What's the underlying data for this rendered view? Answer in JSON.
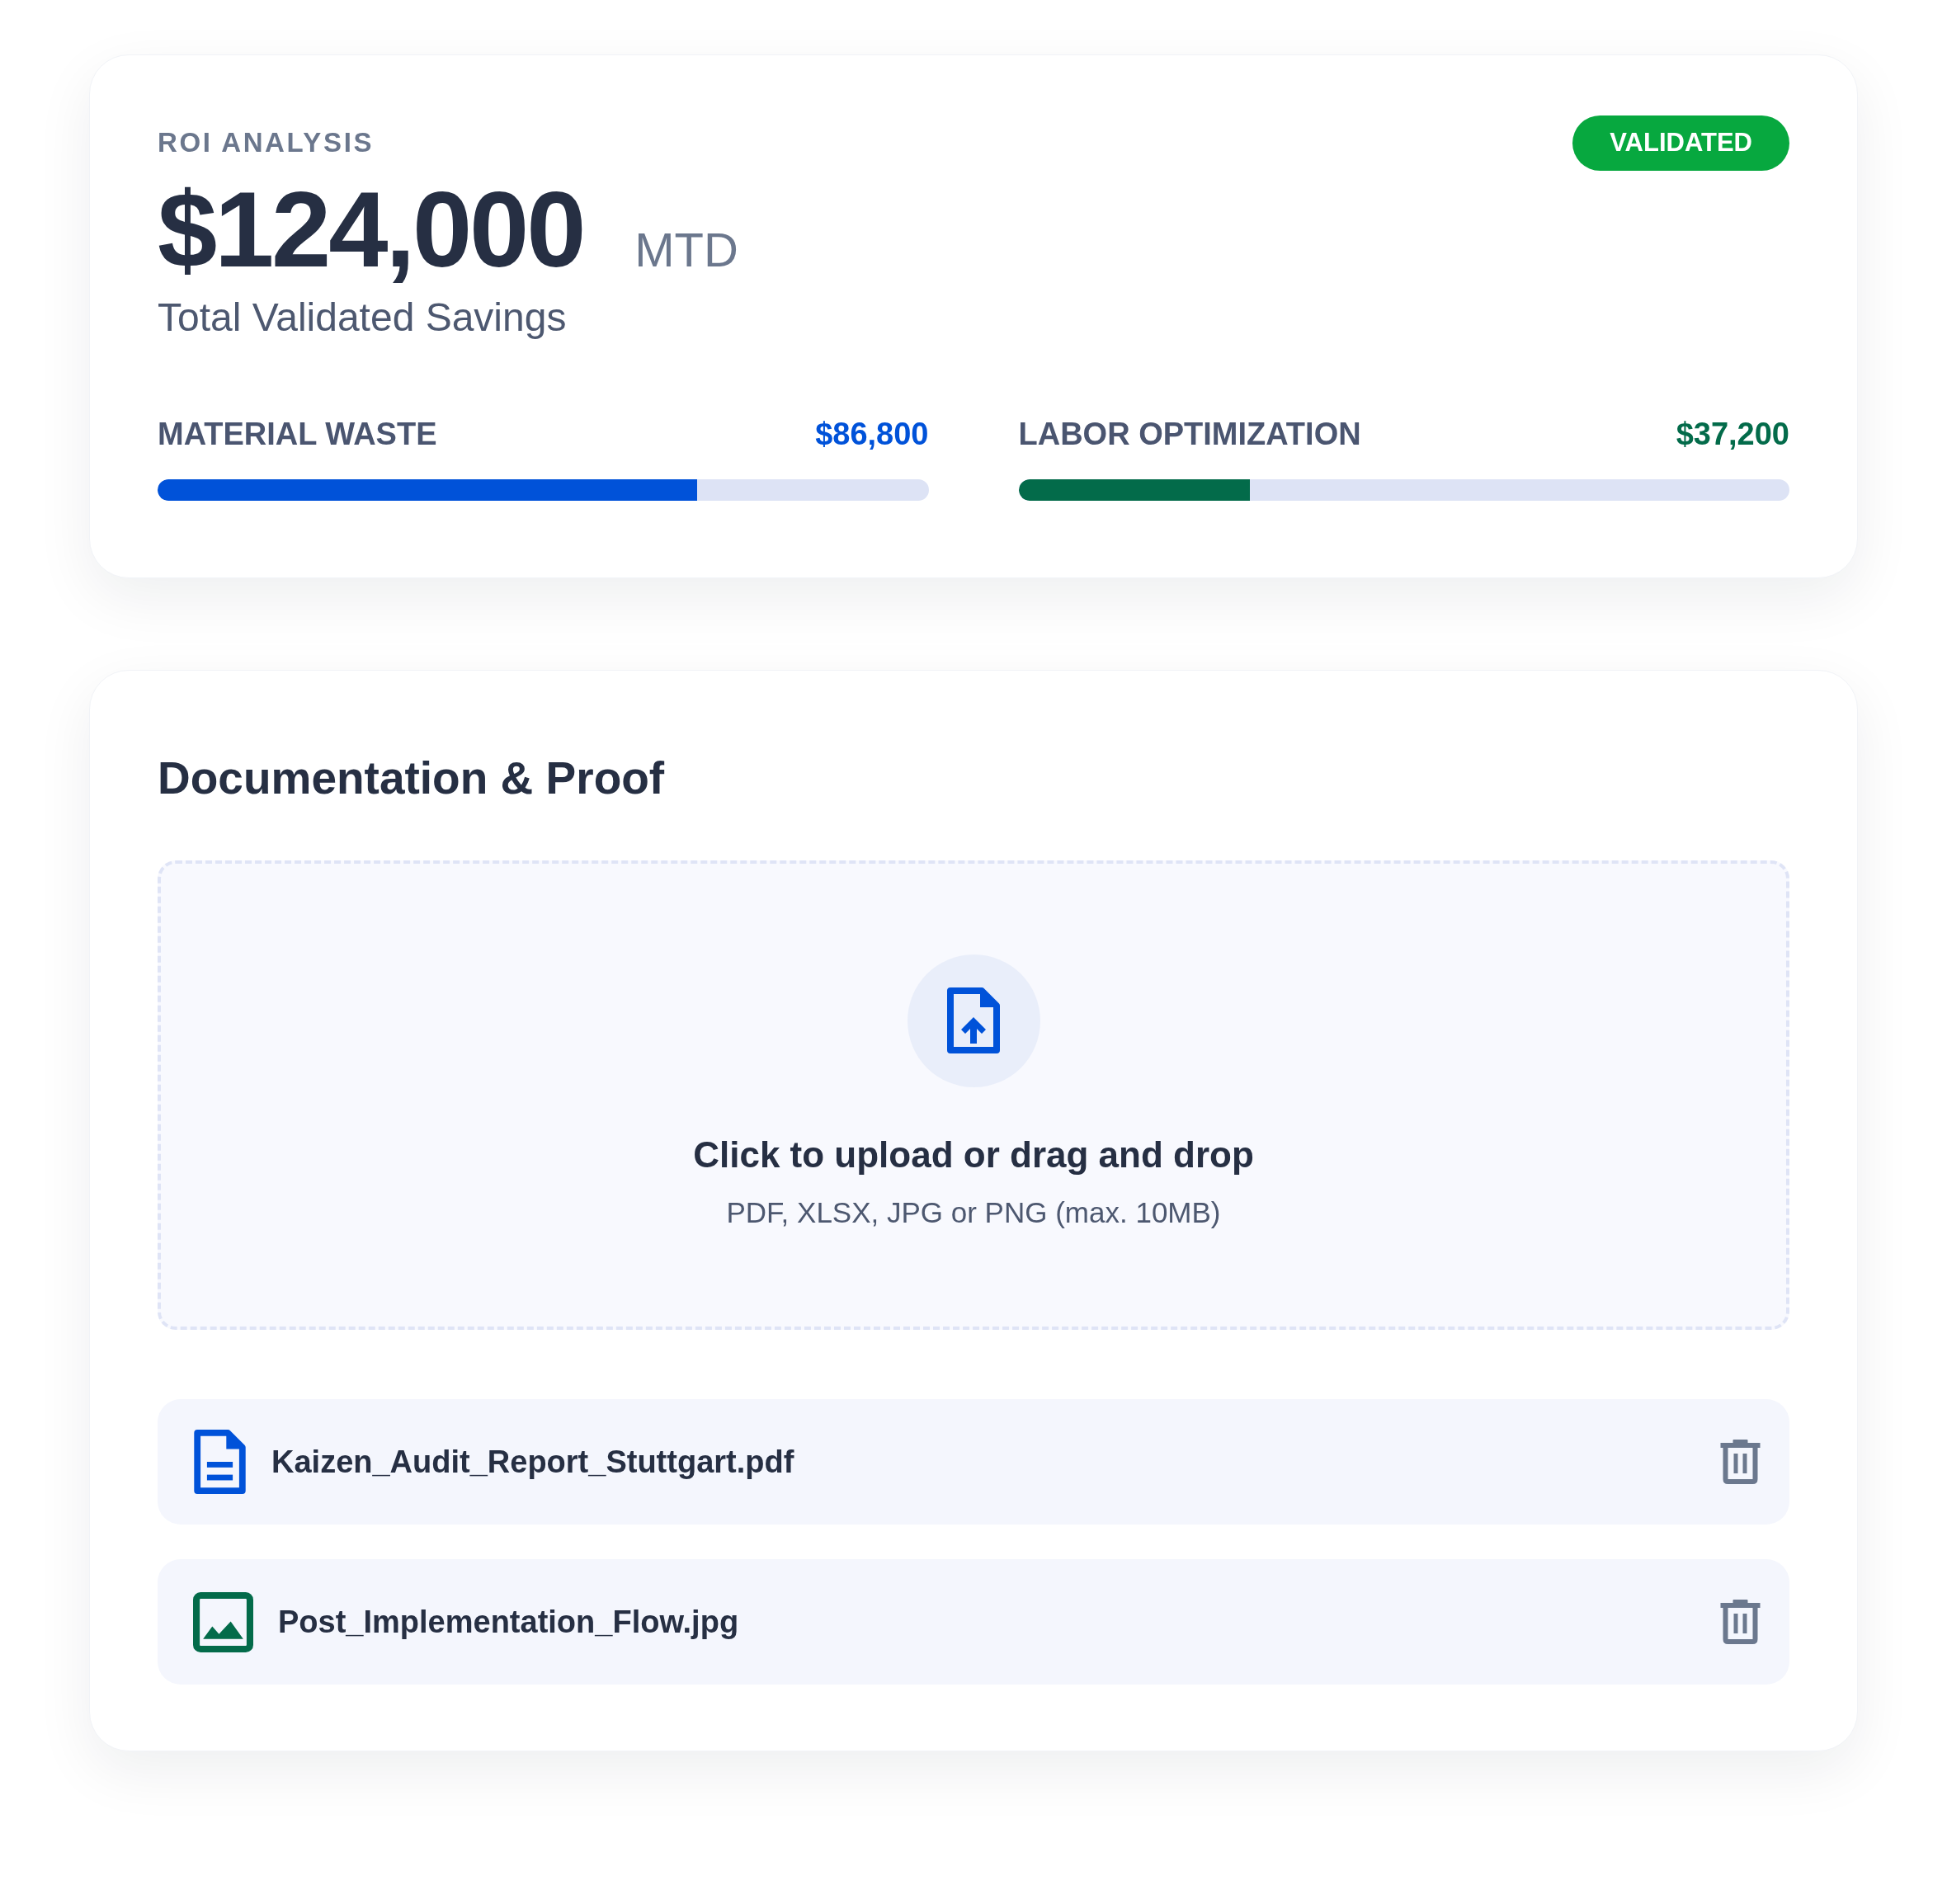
{
  "roi_card": {
    "eyebrow": "ROI ANALYSIS",
    "amount": "$124,000",
    "period": "MTD",
    "subtitle": "Total Validated Savings",
    "badge": "VALIDATED",
    "metrics": [
      {
        "label": "MATERIAL WASTE",
        "value": "$86,800",
        "level": 0.7,
        "color": "#0052d9"
      },
      {
        "label": "LABOR OPTIMIZATION",
        "value": "$37,200",
        "level": 0.3,
        "color": "#036b4a"
      }
    ]
  },
  "documentation_card": {
    "title": "Documentation & Proof",
    "upload": {
      "prompt": "Click to upload or drag and drop",
      "hint": "PDF, XLSX, JPG or PNG (max. 10MB)"
    },
    "files": [
      {
        "name": "Kaizen_Audit_Report_Stuttgart.pdf",
        "kind": "document"
      },
      {
        "name": "Post_Implementation_Flow.jpg",
        "kind": "image"
      }
    ]
  }
}
